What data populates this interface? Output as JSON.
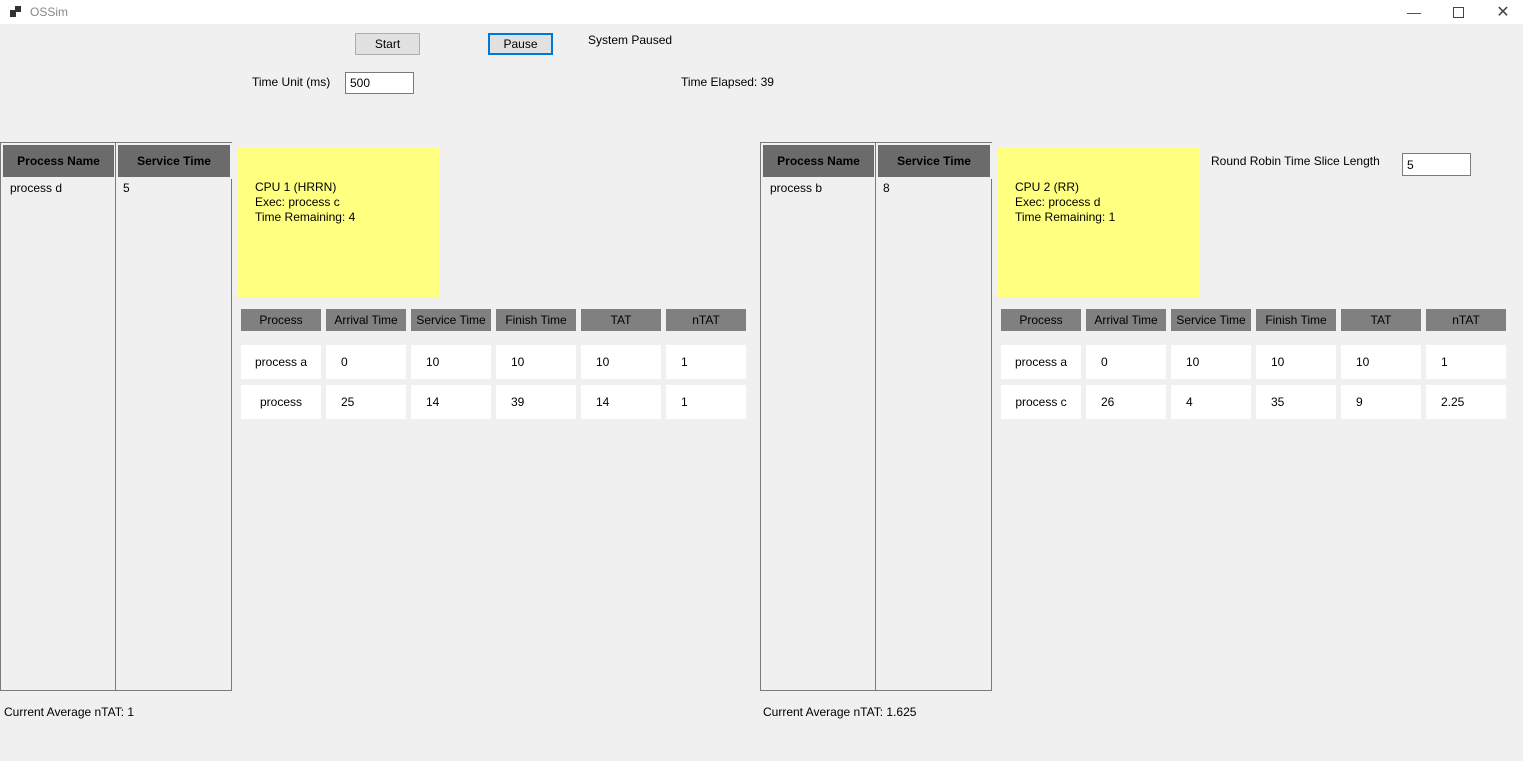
{
  "window": {
    "title": "OSSim",
    "minimize_icon": "minimize-icon",
    "maximize_icon": "maximize-icon",
    "close_icon": "close-icon"
  },
  "controls": {
    "start_label": "Start",
    "pause_label": "Pause",
    "status": "System Paused",
    "time_unit_label": "Time Unit (ms)",
    "time_unit_value": "500",
    "time_elapsed": "Time Elapsed: 39"
  },
  "cpu1": {
    "queue": {
      "headers": [
        "Process Name",
        "Service Time"
      ],
      "rows": [
        {
          "name": "process d",
          "service": "5"
        }
      ]
    },
    "box": {
      "title": "CPU 1 (HRRN)",
      "exec": "Exec:  process c",
      "remaining": "Time Remaining: 4",
      "color": "#ffff80"
    },
    "results": {
      "headers": [
        "Process",
        "Arrival Time",
        "Service Time",
        "Finish Time",
        "TAT",
        "nTAT"
      ],
      "rows": [
        [
          "process a",
          "0",
          "10",
          "10",
          "10",
          "1"
        ],
        [
          "process",
          "25",
          "14",
          "39",
          "14",
          "1"
        ]
      ]
    },
    "avg_ntat": "Current Average nTAT: 1"
  },
  "cpu2": {
    "queue": {
      "headers": [
        "Process Name",
        "Service Time"
      ],
      "rows": [
        {
          "name": "process b",
          "service": "8"
        }
      ]
    },
    "box": {
      "title": "CPU 2 (RR)",
      "exec": "Exec:  process d",
      "remaining": "Time Remaining: 1",
      "color": "#ffff80"
    },
    "rr_label": "Round Robin Time Slice Length",
    "rr_value": "5",
    "results": {
      "headers": [
        "Process",
        "Arrival Time",
        "Service Time",
        "Finish Time",
        "TAT",
        "nTAT"
      ],
      "rows": [
        [
          "process a",
          "0",
          "10",
          "10",
          "10",
          "1"
        ],
        [
          "process c",
          "26",
          "4",
          "35",
          "9",
          "2.25"
        ]
      ]
    },
    "avg_ntat": "Current Average nTAT: 1.625"
  }
}
